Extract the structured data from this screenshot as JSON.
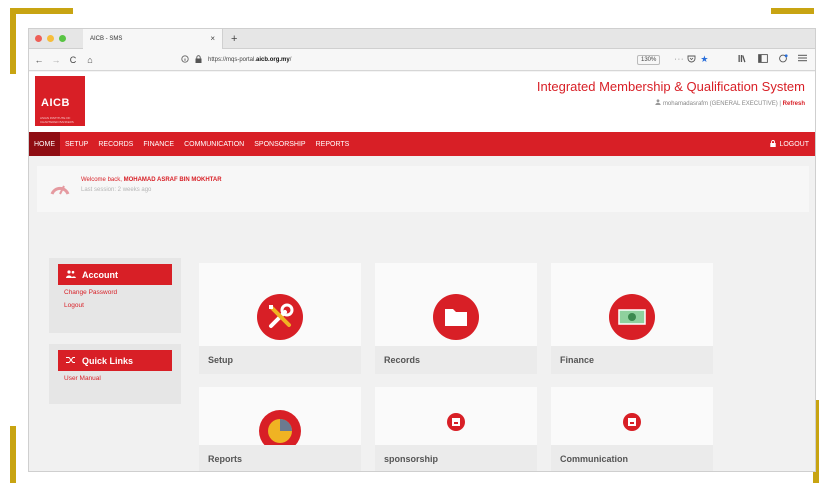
{
  "browser": {
    "tab_title": "AICB - SMS",
    "tab_close": "×",
    "new_tab": "+",
    "url_prefix": "https://mqs-portal.",
    "url_domain": "aicb.org.my",
    "url_suffix": "/",
    "zoom": "130%",
    "page_actions": "···",
    "back_icon": "←",
    "forward_icon": "→",
    "reload_icon": "C",
    "home_icon": "⌂",
    "light_colors": [
      "#ee5f57",
      "#f6bd3b",
      "#58c443"
    ]
  },
  "header": {
    "logo_text": "AICB",
    "logo_tagline": "ASIAN INSTITUTE OF CHARTERED BANKERS",
    "system_title": "Integrated Membership & Qualification System",
    "user_info": "mohamadasrafm (GENERAL EXECUTIVE) |",
    "refresh_label": "Refresh"
  },
  "menu": {
    "items": [
      "HOME",
      "SETUP",
      "RECORDS",
      "FINANCE",
      "COMMUNICATION",
      "SPONSORSHIP",
      "REPORTS"
    ],
    "active": "HOME",
    "logout_label": "LOGOUT"
  },
  "welcome": {
    "prefix": "Welcome back,",
    "name": "MOHAMAD ASRAF BIN MOKHTAR",
    "last_session": "Last session: 2 weeks ago"
  },
  "account_panel": {
    "title": "Account",
    "links": [
      "Change Password",
      "Logout"
    ]
  },
  "quicklinks_panel": {
    "title": "Quick Links",
    "links": [
      "User Manual"
    ]
  },
  "cards": [
    {
      "label": "Setup",
      "icon": "wrench-screwdriver-icon"
    },
    {
      "label": "Records",
      "icon": "folder-icon"
    },
    {
      "label": "Finance",
      "icon": "money-icon"
    },
    {
      "label": "Reports",
      "icon": "pie-chart-icon"
    },
    {
      "label": "sponsorship",
      "icon": "broken-image-icon"
    },
    {
      "label": "Communication",
      "icon": "broken-image-icon"
    }
  ],
  "colors": {
    "brand_red": "#d81f26",
    "active_menu": "#8f0c12",
    "frame_gold": "#c8a412"
  }
}
